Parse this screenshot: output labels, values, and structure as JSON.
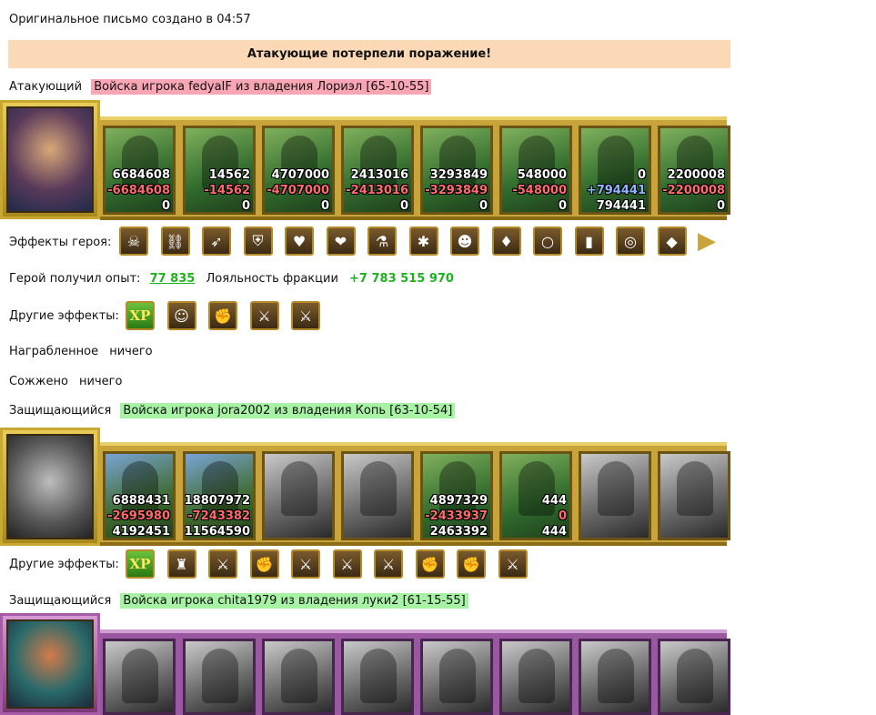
{
  "header": {
    "created_label": "Оригинальное письмо создано в 04:57"
  },
  "banner": {
    "text": "Атакующие потерпели поражение!"
  },
  "attacker": {
    "label": "Атакующий",
    "army": "Войска игрока fedyaIF из владения Лориэл [65-10-55]",
    "units": [
      {
        "n1": "6684608",
        "n2": "-6684608",
        "n3": "0",
        "n2_color": "red"
      },
      {
        "n1": "14562",
        "n2": "-14562",
        "n3": "0",
        "n2_color": "red"
      },
      {
        "n1": "4707000",
        "n2": "-4707000",
        "n3": "0",
        "n2_color": "red"
      },
      {
        "n1": "2413016",
        "n2": "-2413016",
        "n3": "0",
        "n2_color": "red"
      },
      {
        "n1": "3293849",
        "n2": "-3293849",
        "n3": "0",
        "n2_color": "red"
      },
      {
        "n1": "548000",
        "n2": "-548000",
        "n3": "0",
        "n2_color": "red"
      },
      {
        "n1": "0",
        "n2": "+794441",
        "n3": "794441",
        "n2_color": "blue"
      },
      {
        "n1": "2200008",
        "n2": "-2200008",
        "n3": "0",
        "n2_color": "red"
      }
    ],
    "hero_effects_label": "Эффекты героя:",
    "hero_effects_icons": [
      "bone-armor-icon",
      "chain-mail-icon",
      "bow-icon",
      "shield-bow-icon",
      "heart-icon",
      "heart-hand-icon",
      "potion-icon",
      "spider-icon",
      "demon-mask-icon",
      "golden-armor-icon",
      "ring-icon",
      "boots-icon",
      "amulet-icon",
      "gems-icon"
    ],
    "exp_label": "Герой получил опыт:",
    "exp_value": "77 835",
    "loyalty_label": "Лояльность фракции",
    "loyalty_value": "+7 783 515 970",
    "other_effects_label": "Другие эффекты:",
    "other_effects_icons": [
      "xp-icon",
      "dwarf-face-icon",
      "fist-sword-icon",
      "sword-icon",
      "sword-icon"
    ],
    "rewarded_label": "Награбленное",
    "rewarded_value": "ничего",
    "burned_label": "Сожжено",
    "burned_value": "ничего"
  },
  "defender1": {
    "label": "Защищающийся",
    "army": "Войска игрока jora2002 из владения Копь [63-10-54]",
    "units": [
      {
        "n1": "6888431",
        "n2": "-2695980",
        "n3": "4192451",
        "n2_color": "red"
      },
      {
        "n1": "18807972",
        "n2": "-7243382",
        "n3": "11564590",
        "n2_color": "red"
      },
      {
        "n1": "",
        "n2": "",
        "n3": "",
        "n2_color": "red"
      },
      {
        "n1": "",
        "n2": "",
        "n3": "",
        "n2_color": "red"
      },
      {
        "n1": "4897329",
        "n2": "-2433937",
        "n3": "2463392",
        "n2_color": "red"
      },
      {
        "n1": "444",
        "n2": "0",
        "n3": "444",
        "n2_color": "red"
      },
      {
        "n1": "",
        "n2": "",
        "n3": "",
        "n2_color": "red"
      },
      {
        "n1": "",
        "n2": "",
        "n3": "",
        "n2_color": "red"
      }
    ],
    "other_effects_label": "Другие эффекты:",
    "other_effects_icons": [
      "xp-icon",
      "tower-icon",
      "sword-icon",
      "fist-sword-icon",
      "sword-icon",
      "sword-icon",
      "sword-icon",
      "fist-sword-icon",
      "fist-sword-icon",
      "sword-icon"
    ]
  },
  "defender2": {
    "label": "Защищающийся",
    "army": "Войска игрока chita1979 из владения луки2 [61-15-55]"
  },
  "colors": {
    "green_text": "#1fb21f",
    "banner_bg": "#fbd8b6",
    "attacker_tag": "#f8a5b4",
    "defender_tag": "#a7f2a4"
  }
}
